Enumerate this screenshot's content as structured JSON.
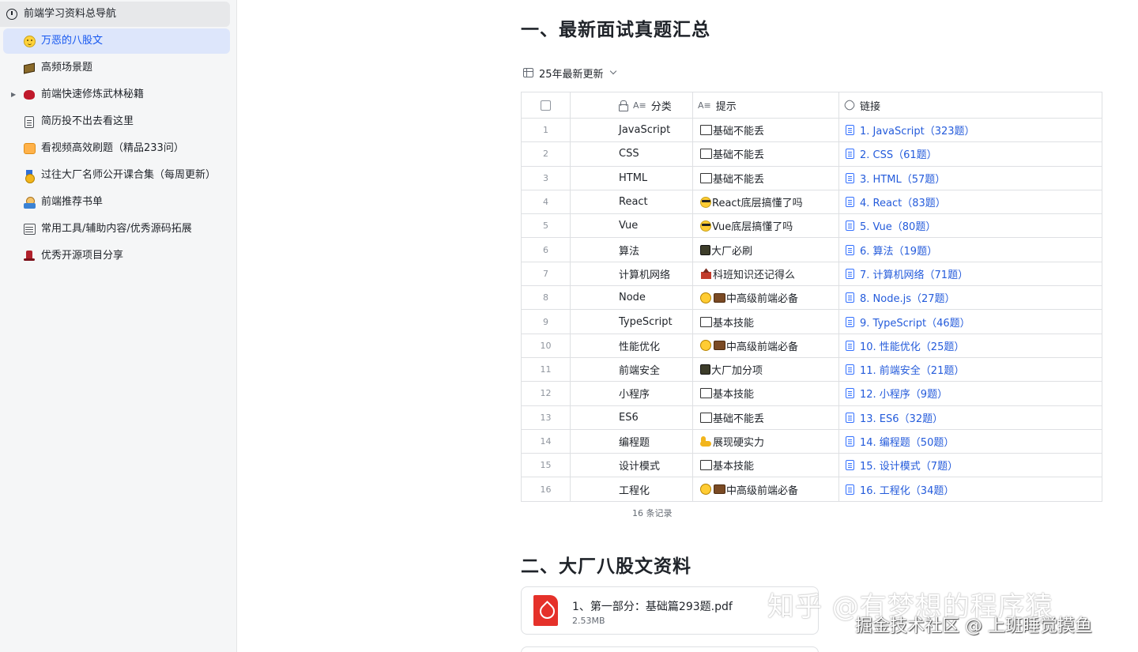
{
  "sidebar": {
    "root": {
      "label": "前端学习资料总导航",
      "icon": "clock-icon"
    },
    "items": [
      {
        "label": "万恶的八股文",
        "icon": "smile-face-icon",
        "active": true,
        "expandable": false
      },
      {
        "label": "高频场景题",
        "icon": "box-icon",
        "active": false,
        "expandable": false
      },
      {
        "label": "前端快速修炼武林秘籍",
        "icon": "bug-icon",
        "active": false,
        "expandable": true
      },
      {
        "label": "简历投不出去看这里",
        "icon": "clipboard-icon",
        "active": false,
        "expandable": false
      },
      {
        "label": "看视频高效刷题（精品233问）",
        "icon": "tv-icon",
        "active": false,
        "expandable": false
      },
      {
        "label": "过往大厂名师公开课合集（每周更新）",
        "icon": "medal-icon",
        "active": false,
        "expandable": false
      },
      {
        "label": "前端推荐书单",
        "icon": "reader-icon",
        "active": false,
        "expandable": false
      },
      {
        "label": "常用工具/辅助内容/优秀源码拓展",
        "icon": "ledger-icon",
        "active": false,
        "expandable": false
      },
      {
        "label": "优秀开源项目分享",
        "icon": "top-hat-icon",
        "active": false,
        "expandable": false
      }
    ]
  },
  "section1": {
    "title": "一、最新面试真题汇总"
  },
  "view": {
    "name": "25年最新更新"
  },
  "table": {
    "headers": {
      "category": "分类",
      "hint": "提示",
      "link": "链接"
    },
    "rows": [
      {
        "no": "1",
        "category": "JavaScript",
        "hint": "基础不能丢",
        "hint_icons": [
          "book"
        ],
        "link": "1. JavaScript（323题）"
      },
      {
        "no": "2",
        "category": "CSS",
        "hint": "基础不能丢",
        "hint_icons": [
          "book"
        ],
        "link": "2. CSS（61题）"
      },
      {
        "no": "3",
        "category": "HTML",
        "hint": "基础不能丢",
        "hint_icons": [
          "book"
        ],
        "link": "3. HTML（57题）"
      },
      {
        "no": "4",
        "category": "React",
        "hint": "React底层搞懂了吗",
        "hint_icons": [
          "cool"
        ],
        "link": "4. React（83题）"
      },
      {
        "no": "5",
        "category": "Vue",
        "hint": "Vue底层搞懂了吗",
        "hint_icons": [
          "cool"
        ],
        "link": "5. Vue（80题）"
      },
      {
        "no": "6",
        "category": "算法",
        "hint": "大厂必刷",
        "hint_icons": [
          "cube"
        ],
        "link": "6. 算法（19题）"
      },
      {
        "no": "7",
        "category": "计算机网络",
        "hint": "科班知识还记得么",
        "hint_icons": [
          "school"
        ],
        "link": "7. 计算机网络（71题）"
      },
      {
        "no": "8",
        "category": "Node",
        "hint": "中高级前端必备",
        "hint_icons": [
          "face",
          "bag"
        ],
        "link": "8. Node.js（27题）"
      },
      {
        "no": "9",
        "category": "TypeScript",
        "hint": "基本技能",
        "hint_icons": [
          "book"
        ],
        "link": "9. TypeScript（46题）"
      },
      {
        "no": "10",
        "category": "性能优化",
        "hint": "中高级前端必备",
        "hint_icons": [
          "face",
          "bag"
        ],
        "link": "10. 性能优化（25题）"
      },
      {
        "no": "11",
        "category": "前端安全",
        "hint": "大厂加分项",
        "hint_icons": [
          "cube"
        ],
        "link": "11. 前端安全（21题）"
      },
      {
        "no": "12",
        "category": "小程序",
        "hint": "基本技能",
        "hint_icons": [
          "book"
        ],
        "link": "12. 小程序（9题）"
      },
      {
        "no": "13",
        "category": "ES6",
        "hint": "基础不能丢",
        "hint_icons": [
          "book"
        ],
        "link": "13. ES6（32题）"
      },
      {
        "no": "14",
        "category": "编程题",
        "hint": "展现硬实力",
        "hint_icons": [
          "arm"
        ],
        "link": "14. 编程题（50题）"
      },
      {
        "no": "15",
        "category": "设计模式",
        "hint": "基本技能",
        "hint_icons": [
          "book"
        ],
        "link": "15. 设计模式（7题）"
      },
      {
        "no": "16",
        "category": "工程化",
        "hint": "中高级前端必备",
        "hint_icons": [
          "face",
          "bag"
        ],
        "link": "16. 工程化（34题）"
      }
    ],
    "record_count": "16 条记录"
  },
  "section2": {
    "title": "二、大厂八股文资料"
  },
  "file": {
    "name": "1、第一部分：基础篇293题.pdf",
    "size": "2.53MB",
    "icon": "pdf-icon"
  },
  "overlay": {
    "line1": "知乎 @有梦想的程序猿",
    "line2": "掘金技术社区 @ 上班睡觉摸鱼"
  },
  "colors": {
    "accent": "#245bdb",
    "active_bg": "#dde6fb",
    "sidebar_bg": "#f5f6f7",
    "pdf_red": "#e5312a"
  }
}
